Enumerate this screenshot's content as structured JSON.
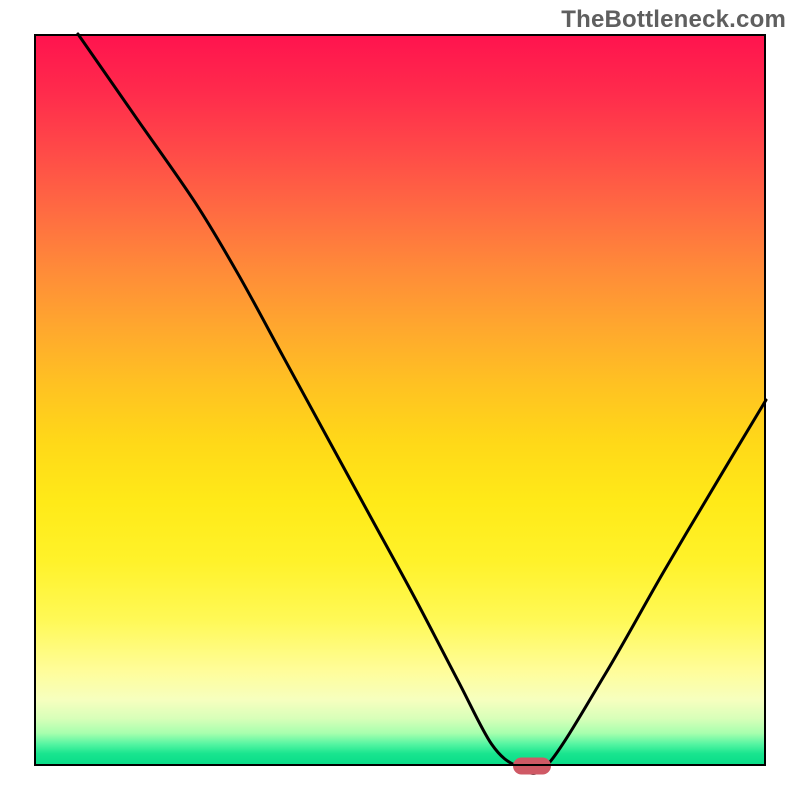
{
  "watermark": "TheBottleneck.com",
  "chart_data": {
    "type": "line",
    "title": "",
    "xlabel": "",
    "ylabel": "",
    "xlim": [
      0,
      100
    ],
    "ylim": [
      0,
      100
    ],
    "grid": false,
    "legend": false,
    "gradient_axis": "vertical",
    "gradient_stops": [
      {
        "pos": 0,
        "color": "#ff134e"
      },
      {
        "pos": 50,
        "color": "#ffd015"
      },
      {
        "pos": 80,
        "color": "#fff956"
      },
      {
        "pos": 100,
        "color": "#06db87"
      }
    ],
    "series": [
      {
        "name": "bottleneck-curve",
        "x": [
          6.0,
          14.0,
          22.0,
          28.0,
          34.0,
          40.0,
          46.0,
          52.0,
          58.0,
          62.5,
          66.0,
          70.0,
          78.0,
          86.0,
          94.0,
          100.0
        ],
        "y": [
          100.0,
          88.5,
          77.0,
          67.0,
          56.0,
          45.0,
          34.0,
          23.0,
          11.5,
          3.0,
          0.0,
          0.0,
          12.5,
          26.5,
          40.0,
          50.0
        ]
      }
    ],
    "marker": {
      "name": "optimal-marker",
      "x": 68.0,
      "y": 0.0,
      "color": "#cf5965"
    }
  }
}
